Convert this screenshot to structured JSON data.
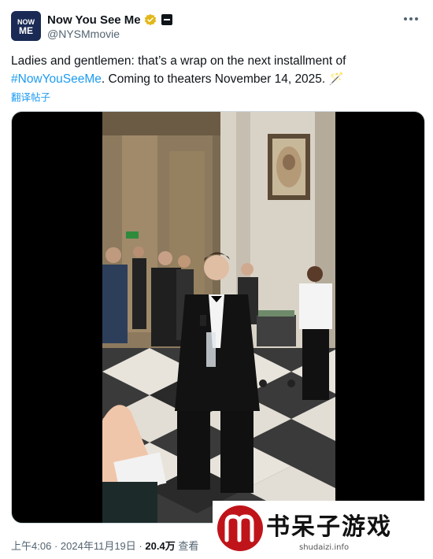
{
  "author": {
    "display_name": "Now You See Me",
    "handle": "@NYSMmovie",
    "verified": true,
    "avatar_text": "NOW ME"
  },
  "tweet": {
    "text_prefix": "Ladies and gentlemen: that’s a wrap on the next installment of",
    "hashtag": "#NowYouSeeMe",
    "text_suffix": ". Coming to theaters November 14, 2025. ",
    "emoji": "🪄",
    "translate_label": "翻译帖子"
  },
  "meta": {
    "time": "上午4:06",
    "date": "2024年11月19日",
    "separator": "·",
    "views_count": "20.4万",
    "views_label": "查看"
  },
  "watermark": {
    "title": "书呆子游戏",
    "subtitle": "shudaizi.info"
  },
  "colors": {
    "accent": "#1d9bf0",
    "verified_gold": "#e2b719",
    "watermark_red": "#c0141b"
  }
}
